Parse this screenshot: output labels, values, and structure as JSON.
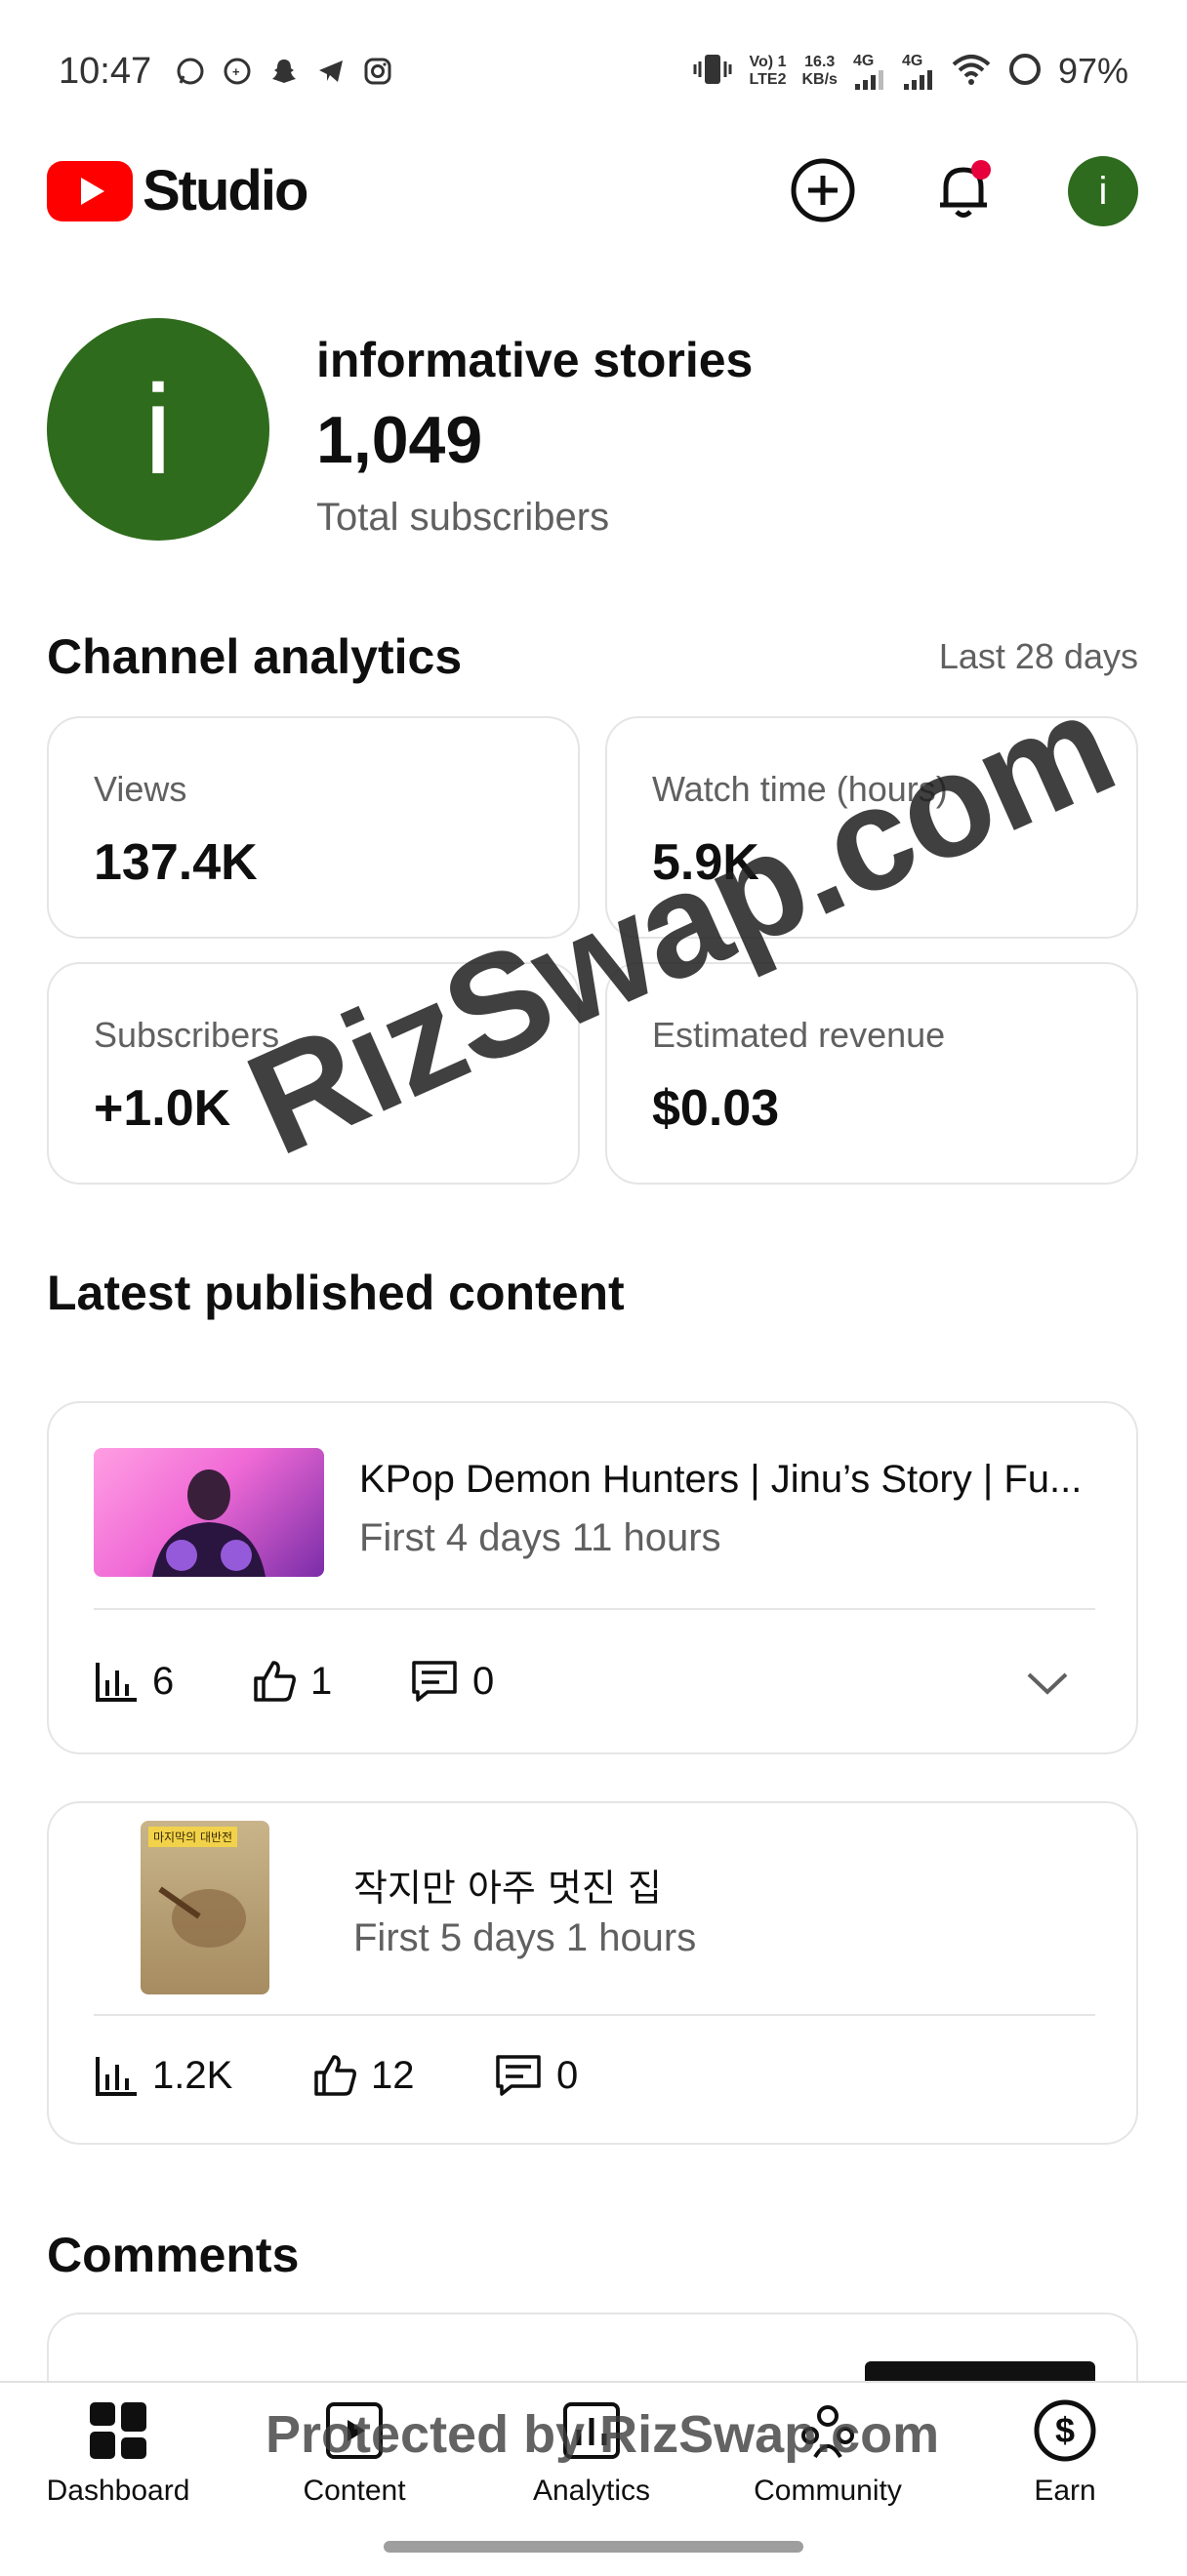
{
  "status_bar": {
    "time": "10:47",
    "network_top": "Vo) 1",
    "network_bottom": "LTE2",
    "speed_top": "16.3",
    "speed_bottom": "KB/s",
    "sig1": "4G",
    "sig2": "4G",
    "battery": "97%"
  },
  "header": {
    "app_name": "Studio",
    "avatar_letter": "i"
  },
  "channel": {
    "avatar_letter": "i",
    "name": "informative stories",
    "subscribers": "1,049",
    "subscribers_label": "Total subscribers"
  },
  "analytics": {
    "title": "Channel analytics",
    "range": "Last 28 days",
    "metrics": [
      {
        "label": "Views",
        "value": "137.4K"
      },
      {
        "label": "Watch time (hours)",
        "value": "5.9K"
      },
      {
        "label": "Subscribers",
        "value": "+1.0K"
      },
      {
        "label": "Estimated revenue",
        "value": "$0.03"
      }
    ]
  },
  "latest": {
    "title": "Latest published content",
    "items": [
      {
        "title": "KPop Demon Hunters | Jinu’s Story | Fu...",
        "subtitle": "First 4 days 11 hours",
        "views": "6",
        "likes": "1",
        "comments": "0"
      },
      {
        "title": "작지만 아주 멋진 집",
        "subtitle": "First 5 days 1 hours",
        "views": "1.2K",
        "likes": "12",
        "comments": "0",
        "thumb_caption": "마지막의 대반전"
      }
    ]
  },
  "comments": {
    "title": "Comments"
  },
  "watermark": {
    "main": "RizSwap.com",
    "footer": "Protected by RizSwap.com"
  },
  "nav": {
    "items": [
      {
        "label": "Dashboard"
      },
      {
        "label": "Content"
      },
      {
        "label": "Analytics"
      },
      {
        "label": "Community"
      },
      {
        "label": "Earn"
      }
    ]
  },
  "colors": {
    "brand_red": "#ff0000",
    "avatar_green": "#2f6b1c",
    "notification_dot": "#e6003c"
  }
}
